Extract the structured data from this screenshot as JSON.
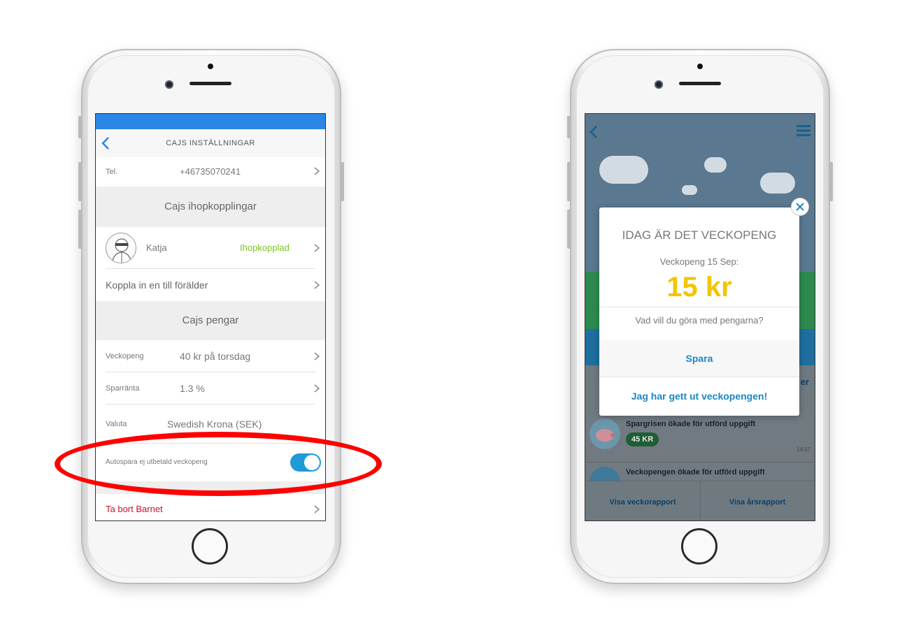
{
  "left_phone": {
    "nav_title": "CAJS INSTÄLLNINGAR",
    "phone_row": {
      "label": "Tel.",
      "value": "+46735070241"
    },
    "links_section_title": "Cajs ihopkopplingar",
    "linked_parent": {
      "name": "Katja",
      "status": "Ihopkopplad"
    },
    "add_parent_label": "Koppla in en till förälder",
    "money_section_title": "Cajs pengar",
    "allowance_row": {
      "label": "Veckopeng",
      "value": "40 kr på torsdag"
    },
    "interest_row": {
      "label": "Sparränta",
      "value": "1.3 %"
    },
    "currency_row": {
      "label": "Valuta",
      "value": "Swedish Krona (SEK)"
    },
    "autosave_row": {
      "label": "Autospara ej utbetald veckopeng",
      "enabled": true
    },
    "remove_child_label": "Ta bort Barnet"
  },
  "right_phone": {
    "modal": {
      "title": "IDAG ÄR DET VECKOPENG",
      "subtitle": "Veckopeng 15 Sep:",
      "amount": "15 kr",
      "question": "Vad vill du göra med pengarna?",
      "save_button": "Spara",
      "paid_out_button": "Jag har gett ut veckopengen!"
    },
    "tab_peek": "er",
    "feed": [
      {
        "text": "Spargrisen ökade för utförd uppgift",
        "badge": "45 KR",
        "time": "14:57"
      },
      {
        "text": "Veckopengen ökade för utförd uppgift",
        "badge": "",
        "time": ""
      }
    ],
    "bottom_tabs": [
      "Visa veckorapport",
      "Visa årsrapport"
    ]
  },
  "colors": {
    "accent_blue": "#2b86e6",
    "linked_green": "#7cc21f",
    "remove_red": "#c8102e",
    "amount_yellow": "#f5c400",
    "highlight_red": "#ff0000",
    "toggle_on": "#1f9bd7"
  }
}
